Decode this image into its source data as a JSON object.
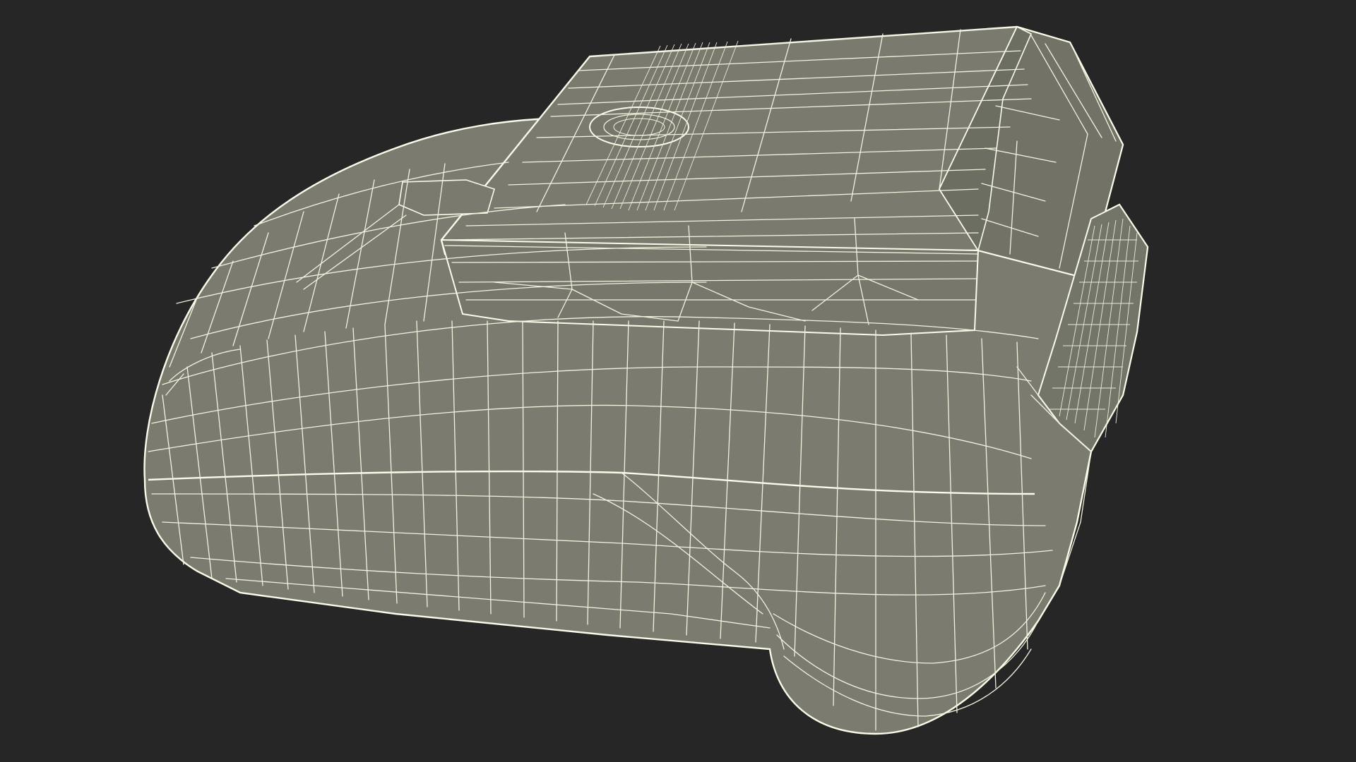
{
  "scene": {
    "subject": "wireframe-3d-model",
    "background_color": "#262626",
    "mesh_fill_color": "#7b7c6f",
    "mesh_fill_shade_color": "#6f7064",
    "wire_color": "#f2f2df"
  }
}
